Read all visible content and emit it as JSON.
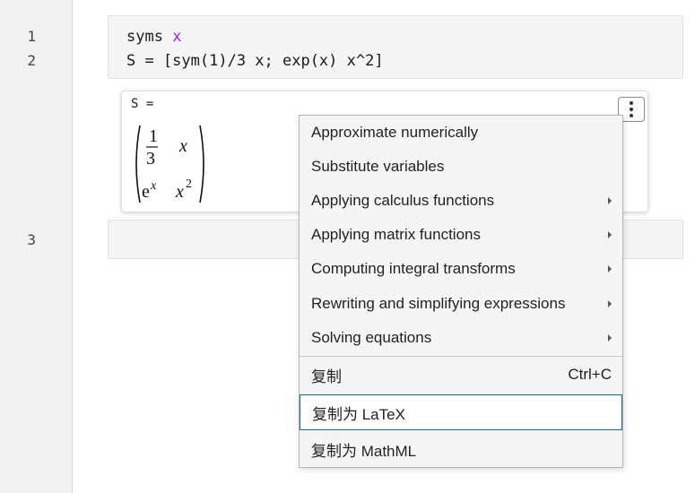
{
  "gutter": {
    "line_numbers": [
      "1",
      "2",
      "3"
    ]
  },
  "code": {
    "line1_keyword": "syms ",
    "line1_var": "x",
    "line2": "S = [sym(1)/3 x; exp(x) x^2]"
  },
  "output": {
    "label": "S =",
    "matrix": {
      "r1c1_num": "1",
      "r1c1_den": "3",
      "r1c2": "x",
      "r2c1_base": "e",
      "r2c1_exp": "x",
      "r2c2_base": "x",
      "r2c2_exp": "2"
    },
    "options_icon": "kebab-menu-icon"
  },
  "context_menu": {
    "items": [
      {
        "label": "Approximate numerically",
        "submenu": false
      },
      {
        "label": "Substitute variables",
        "submenu": false
      },
      {
        "label": "Applying calculus functions",
        "submenu": true
      },
      {
        "label": "Applying matrix functions",
        "submenu": true
      },
      {
        "label": "Computing integral transforms",
        "submenu": true
      },
      {
        "label": "Rewriting and simplifying expressions",
        "submenu": true
      },
      {
        "label": "Solving equations",
        "submenu": true
      }
    ],
    "copy_items": [
      {
        "label": "复制",
        "shortcut": "Ctrl+C"
      },
      {
        "label": "复制为 LaTeX",
        "shortcut": ""
      },
      {
        "label": "复制为 MathML",
        "shortcut": ""
      }
    ],
    "focused_color": "#1a6a8e"
  }
}
